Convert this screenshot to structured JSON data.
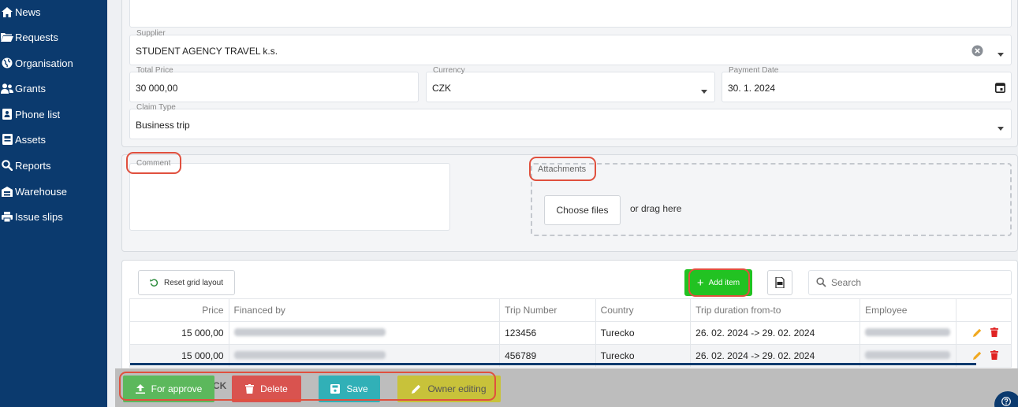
{
  "sidebar": {
    "items": [
      {
        "label": "News",
        "icon": "home-icon"
      },
      {
        "label": "Requests",
        "icon": "folder-icon"
      },
      {
        "label": "Organisation",
        "icon": "globe-icon"
      },
      {
        "label": "Grants",
        "icon": "users-icon"
      },
      {
        "label": "Phone list",
        "icon": "phone-book-icon"
      },
      {
        "label": "Assets",
        "icon": "briefcase-icon"
      },
      {
        "label": "Reports",
        "icon": "search-icon"
      },
      {
        "label": "Warehouse",
        "icon": "warehouse-icon"
      },
      {
        "label": "Issue slips",
        "icon": "printer-icon"
      }
    ]
  },
  "form": {
    "supplier_label": "Supplier",
    "supplier_value": "STUDENT AGENCY TRAVEL k.s.",
    "total_price_label": "Total Price",
    "total_price_value": "30 000,00",
    "currency_label": "Currency",
    "currency_value": "CZK",
    "payment_date_label": "Payment Date",
    "payment_date_value": "30. 1. 2024",
    "claim_type_label": "Claim Type",
    "claim_type_value": "Business trip"
  },
  "comment": {
    "label": "Comment"
  },
  "attachments": {
    "label": "Attachments",
    "choose_label": "Choose files",
    "drag_label": "or drag here"
  },
  "toolbar": {
    "reset_label": "Reset grid layout",
    "add_label": "Add item",
    "search_placeholder": "Search"
  },
  "grid": {
    "columns": [
      "Price",
      "Financed by",
      "Trip Number",
      "Country",
      "Trip duration from-to",
      "Employee"
    ],
    "rows": [
      {
        "price": "15 000,00",
        "trip_number": "123456",
        "country": "Turecko",
        "duration": "26. 02. 2024 -> 29. 02. 2024"
      },
      {
        "price": "15 000,00",
        "trip_number": "456789",
        "country": "Turecko",
        "duration": "26. 02. 2024 -> 29. 02. 2024"
      }
    ]
  },
  "actions": {
    "approve_label": "For approve",
    "delete_label": "Delete",
    "save_label": "Save",
    "owner_label": "Owner editing",
    "hidden_fragment": "CK"
  },
  "colors": {
    "sidebar": "#0b3a6e",
    "approve": "#5cb85c",
    "delete": "#d9534f",
    "save": "#31b0b7",
    "owner": "#c8c23a",
    "add": "#22c222",
    "highlight": "#e0503e"
  }
}
